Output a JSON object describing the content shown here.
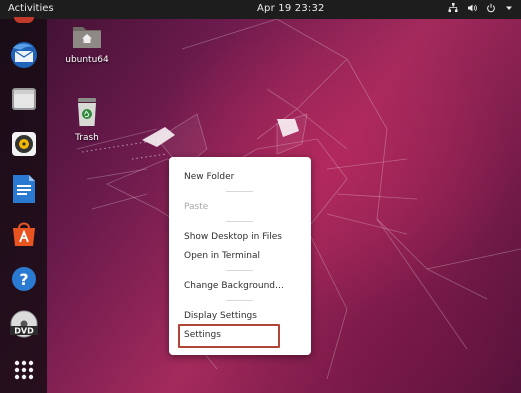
{
  "topbar": {
    "activities": "Activities",
    "clock": "Apr 19  23:32",
    "tray_icons": [
      "network-icon",
      "volume-icon",
      "power-icon",
      "menu-arrow-icon"
    ]
  },
  "dock": {
    "items": [
      "thunderbird-icon",
      "files-icon",
      "rhythmbox-icon",
      "libreoffice-writer-icon",
      "software-center-icon",
      "help-icon",
      "dvd-icon",
      "show-apps-icon"
    ],
    "dvd_label": "DVD"
  },
  "desktop": {
    "icons": [
      {
        "label": "ubuntu64"
      },
      {
        "label": "Trash"
      }
    ]
  },
  "context_menu": {
    "new_folder": "New Folder",
    "paste": "Paste",
    "show_desktop_in_files": "Show Desktop in Files",
    "open_in_terminal": "Open in Terminal",
    "change_background": "Change Background…",
    "display_settings": "Display Settings",
    "settings": "Settings"
  },
  "colors": {
    "topbar": "#1d1d1d",
    "highlight_border": "#b2453a",
    "wallpaper_accent": "#a42a5c"
  }
}
